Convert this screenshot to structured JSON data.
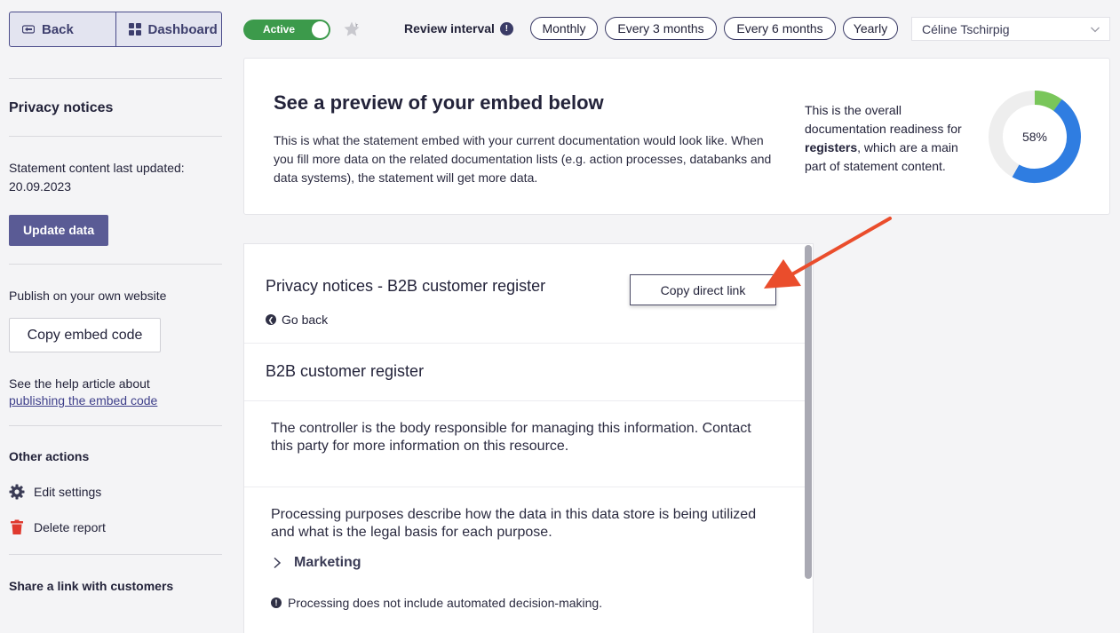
{
  "nav": {
    "back_label": "Back",
    "dashboard_label": "Dashboard"
  },
  "sidebar": {
    "section_title": "Privacy notices",
    "updated_label": "Statement content last updated:",
    "updated_date": "20.09.2023",
    "update_button": "Update data",
    "publish_text": "Publish on your own website",
    "copy_embed_button": "Copy embed code",
    "help_text": "See the help article about",
    "help_link": "publishing the embed code",
    "other_actions_title": "Other actions",
    "actions": [
      {
        "label": "Edit settings",
        "icon": "gear-icon"
      },
      {
        "label": "Delete report",
        "icon": "trash-icon"
      }
    ],
    "share_title": "Share a link with customers"
  },
  "topbar": {
    "status_toggle": "Active",
    "status_on": true,
    "review_label": "Review interval",
    "intervals": [
      "Monthly",
      "Every 3 months",
      "Every 6 months",
      "Yearly"
    ],
    "assignee": "Céline Tschirpig"
  },
  "preview": {
    "title": "See a preview of your embed below",
    "description": "This is what the statement embed with your current documentation would look like. When you fill more data on the related documentation lists (e.g. action processes, databanks and data systems), the statement will get more data.",
    "readiness_before": "This is the overall documentation readiness for ",
    "readiness_bold": "registers",
    "readiness_after": ", which are a main part of statement content.",
    "readiness_percent": 58,
    "readiness_label": "58%",
    "colors": {
      "track": "#eeeeee",
      "primary": "#2f7de1",
      "secondary": "#79c65a"
    }
  },
  "embed": {
    "header_title": "Privacy notices - B2B customer register",
    "copy_direct_link": "Copy direct link",
    "go_back": "Go back",
    "register_title": "B2B customer register",
    "controller_text": "The controller is the body responsible for managing this information. Contact this party for more information on this resource.",
    "purposes_text": "Processing purposes describe how the data in this data store is being utilized and what is the legal basis for each purpose.",
    "purpose_item": "Marketing",
    "automated_notice": "Processing does not include automated decision-making."
  },
  "annotation": {
    "arrow_color": "#ea4d2c"
  }
}
